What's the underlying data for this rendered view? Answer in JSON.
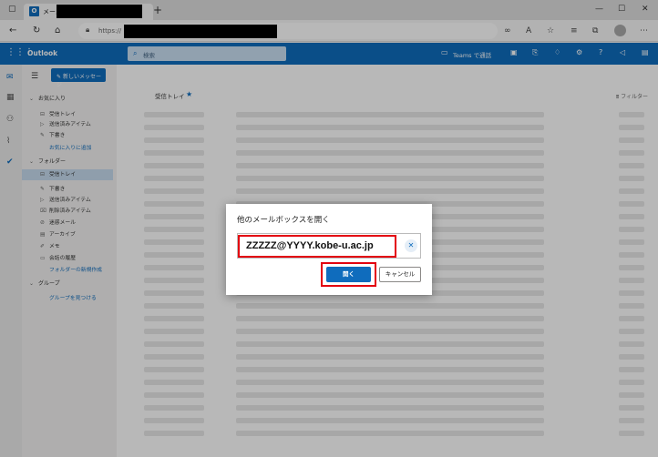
{
  "browser": {
    "tab_title": "メール",
    "url_prefix": "https://",
    "new_tab_glyph": "+"
  },
  "outlook": {
    "brand": "Outlook",
    "search_placeholder": "検索",
    "teams_label": "Teams で通話"
  },
  "folder_pane": {
    "new_message": "新しいメッセージ",
    "favorites_header": "お気に入り",
    "favorites": [
      {
        "label": "受信トレイ",
        "icon": "inbox-icon"
      },
      {
        "label": "送信済みアイテム",
        "icon": "send-icon"
      },
      {
        "label": "下書き",
        "icon": "draft-icon"
      }
    ],
    "add_favorite": "お気に入りに追加",
    "folders_header": "フォルダー",
    "folders": [
      {
        "label": "受信トレイ",
        "icon": "inbox-icon"
      },
      {
        "label": "下書き",
        "icon": "draft-icon"
      },
      {
        "label": "送信済みアイテム",
        "icon": "send-icon"
      },
      {
        "label": "削除済みアイテム",
        "icon": "trash-icon"
      },
      {
        "label": "迷惑メール",
        "icon": "junk-icon"
      },
      {
        "label": "アーカイブ",
        "icon": "archive-icon"
      },
      {
        "label": "メモ",
        "icon": "note-icon"
      },
      {
        "label": "会話の履歴",
        "icon": "folder-icon"
      }
    ],
    "new_folder": "フォルダーの新規作成",
    "groups_header": "グループ",
    "discover_groups": "グループを見つける"
  },
  "message_list": {
    "title": "受信トレイ",
    "filter": "フィルター"
  },
  "dialog": {
    "title": "他のメールボックスを開く",
    "mailbox_value": "ZZZZZ@YYYY.kobe-u.ac.jp",
    "open_label": "開く",
    "cancel_label": "キャンセル"
  },
  "colors": {
    "accent": "#0f6cbd",
    "highlight": "#e3000f"
  }
}
